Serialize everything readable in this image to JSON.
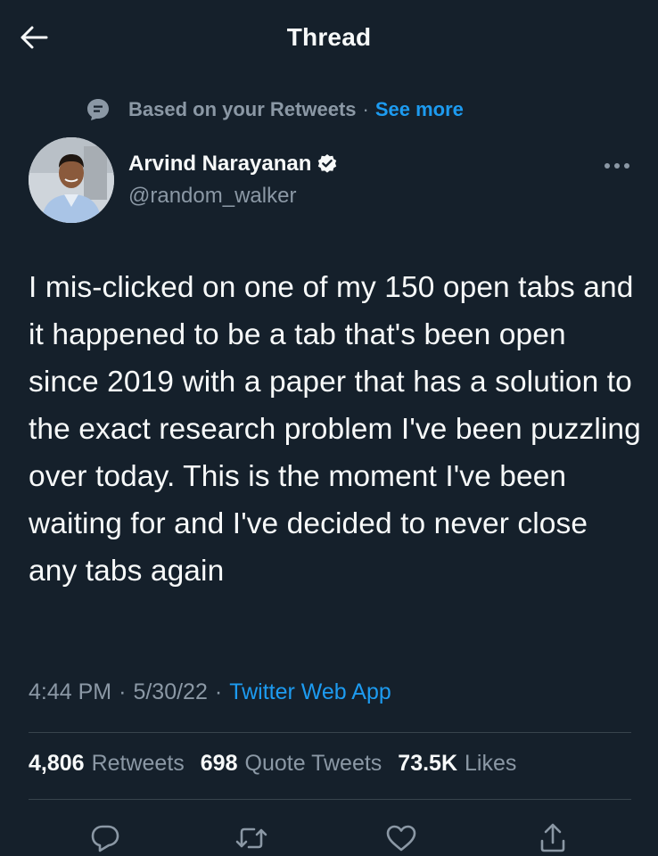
{
  "header": {
    "title": "Thread",
    "back_icon": "arrow-left-icon"
  },
  "context": {
    "icon": "chat-bubble-icon",
    "text": "Based on your Retweets",
    "separator": "·",
    "see_more": "See more"
  },
  "author": {
    "name": "Arvind Narayanan",
    "handle": "@random_walker",
    "verified": true,
    "avatar_icon": "avatar"
  },
  "tweet": {
    "text": "I mis-clicked on one of my 150 open tabs and it happened to be a tab that's been open since 2019 with a paper that has a solution to the exact research problem I've been puzzling over today. This is the moment I've been waiting for and I've decided to never close any tabs again",
    "time": "4:44 PM",
    "date": "5/30/22",
    "separator": "·",
    "source": "Twitter Web App"
  },
  "stats": {
    "retweets_count": "4,806",
    "retweets_label": "Retweets",
    "quotes_count": "698",
    "quotes_label": "Quote Tweets",
    "likes_count": "73.5K",
    "likes_label": "Likes"
  },
  "actions": [
    "reply-icon",
    "retweet-icon",
    "like-icon",
    "share-icon"
  ],
  "colors": {
    "background": "#15202b",
    "text": "#f7f9f9",
    "secondary": "#8b98a5",
    "accent": "#1d9bf0",
    "divider": "#38444d"
  }
}
